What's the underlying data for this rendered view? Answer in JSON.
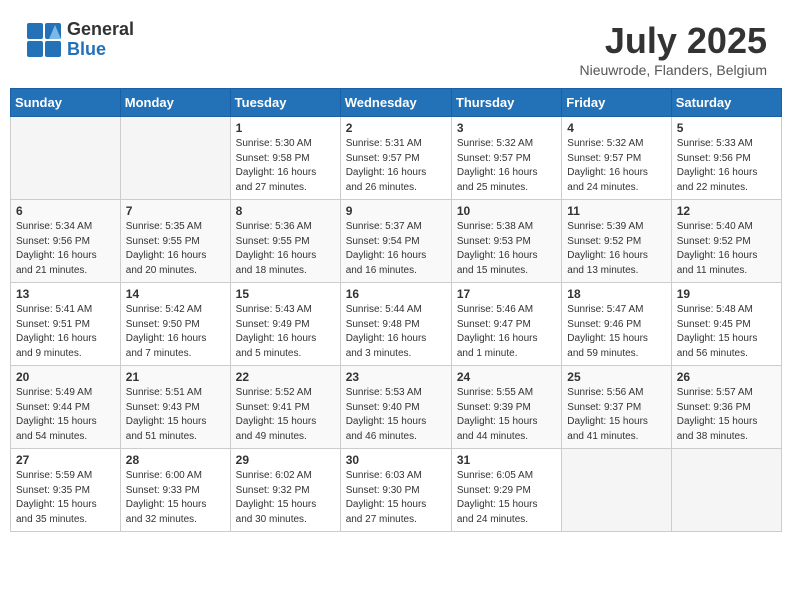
{
  "header": {
    "logo_general": "General",
    "logo_blue": "Blue",
    "month_year": "July 2025",
    "location": "Nieuwrode, Flanders, Belgium"
  },
  "weekdays": [
    "Sunday",
    "Monday",
    "Tuesday",
    "Wednesday",
    "Thursday",
    "Friday",
    "Saturday"
  ],
  "weeks": [
    [
      {
        "day": "",
        "info": ""
      },
      {
        "day": "",
        "info": ""
      },
      {
        "day": "1",
        "info": "Sunrise: 5:30 AM\nSunset: 9:58 PM\nDaylight: 16 hours\nand 27 minutes."
      },
      {
        "day": "2",
        "info": "Sunrise: 5:31 AM\nSunset: 9:57 PM\nDaylight: 16 hours\nand 26 minutes."
      },
      {
        "day": "3",
        "info": "Sunrise: 5:32 AM\nSunset: 9:57 PM\nDaylight: 16 hours\nand 25 minutes."
      },
      {
        "day": "4",
        "info": "Sunrise: 5:32 AM\nSunset: 9:57 PM\nDaylight: 16 hours\nand 24 minutes."
      },
      {
        "day": "5",
        "info": "Sunrise: 5:33 AM\nSunset: 9:56 PM\nDaylight: 16 hours\nand 22 minutes."
      }
    ],
    [
      {
        "day": "6",
        "info": "Sunrise: 5:34 AM\nSunset: 9:56 PM\nDaylight: 16 hours\nand 21 minutes."
      },
      {
        "day": "7",
        "info": "Sunrise: 5:35 AM\nSunset: 9:55 PM\nDaylight: 16 hours\nand 20 minutes."
      },
      {
        "day": "8",
        "info": "Sunrise: 5:36 AM\nSunset: 9:55 PM\nDaylight: 16 hours\nand 18 minutes."
      },
      {
        "day": "9",
        "info": "Sunrise: 5:37 AM\nSunset: 9:54 PM\nDaylight: 16 hours\nand 16 minutes."
      },
      {
        "day": "10",
        "info": "Sunrise: 5:38 AM\nSunset: 9:53 PM\nDaylight: 16 hours\nand 15 minutes."
      },
      {
        "day": "11",
        "info": "Sunrise: 5:39 AM\nSunset: 9:52 PM\nDaylight: 16 hours\nand 13 minutes."
      },
      {
        "day": "12",
        "info": "Sunrise: 5:40 AM\nSunset: 9:52 PM\nDaylight: 16 hours\nand 11 minutes."
      }
    ],
    [
      {
        "day": "13",
        "info": "Sunrise: 5:41 AM\nSunset: 9:51 PM\nDaylight: 16 hours\nand 9 minutes."
      },
      {
        "day": "14",
        "info": "Sunrise: 5:42 AM\nSunset: 9:50 PM\nDaylight: 16 hours\nand 7 minutes."
      },
      {
        "day": "15",
        "info": "Sunrise: 5:43 AM\nSunset: 9:49 PM\nDaylight: 16 hours\nand 5 minutes."
      },
      {
        "day": "16",
        "info": "Sunrise: 5:44 AM\nSunset: 9:48 PM\nDaylight: 16 hours\nand 3 minutes."
      },
      {
        "day": "17",
        "info": "Sunrise: 5:46 AM\nSunset: 9:47 PM\nDaylight: 16 hours\nand 1 minute."
      },
      {
        "day": "18",
        "info": "Sunrise: 5:47 AM\nSunset: 9:46 PM\nDaylight: 15 hours\nand 59 minutes."
      },
      {
        "day": "19",
        "info": "Sunrise: 5:48 AM\nSunset: 9:45 PM\nDaylight: 15 hours\nand 56 minutes."
      }
    ],
    [
      {
        "day": "20",
        "info": "Sunrise: 5:49 AM\nSunset: 9:44 PM\nDaylight: 15 hours\nand 54 minutes."
      },
      {
        "day": "21",
        "info": "Sunrise: 5:51 AM\nSunset: 9:43 PM\nDaylight: 15 hours\nand 51 minutes."
      },
      {
        "day": "22",
        "info": "Sunrise: 5:52 AM\nSunset: 9:41 PM\nDaylight: 15 hours\nand 49 minutes."
      },
      {
        "day": "23",
        "info": "Sunrise: 5:53 AM\nSunset: 9:40 PM\nDaylight: 15 hours\nand 46 minutes."
      },
      {
        "day": "24",
        "info": "Sunrise: 5:55 AM\nSunset: 9:39 PM\nDaylight: 15 hours\nand 44 minutes."
      },
      {
        "day": "25",
        "info": "Sunrise: 5:56 AM\nSunset: 9:37 PM\nDaylight: 15 hours\nand 41 minutes."
      },
      {
        "day": "26",
        "info": "Sunrise: 5:57 AM\nSunset: 9:36 PM\nDaylight: 15 hours\nand 38 minutes."
      }
    ],
    [
      {
        "day": "27",
        "info": "Sunrise: 5:59 AM\nSunset: 9:35 PM\nDaylight: 15 hours\nand 35 minutes."
      },
      {
        "day": "28",
        "info": "Sunrise: 6:00 AM\nSunset: 9:33 PM\nDaylight: 15 hours\nand 32 minutes."
      },
      {
        "day": "29",
        "info": "Sunrise: 6:02 AM\nSunset: 9:32 PM\nDaylight: 15 hours\nand 30 minutes."
      },
      {
        "day": "30",
        "info": "Sunrise: 6:03 AM\nSunset: 9:30 PM\nDaylight: 15 hours\nand 27 minutes."
      },
      {
        "day": "31",
        "info": "Sunrise: 6:05 AM\nSunset: 9:29 PM\nDaylight: 15 hours\nand 24 minutes."
      },
      {
        "day": "",
        "info": ""
      },
      {
        "day": "",
        "info": ""
      }
    ]
  ]
}
